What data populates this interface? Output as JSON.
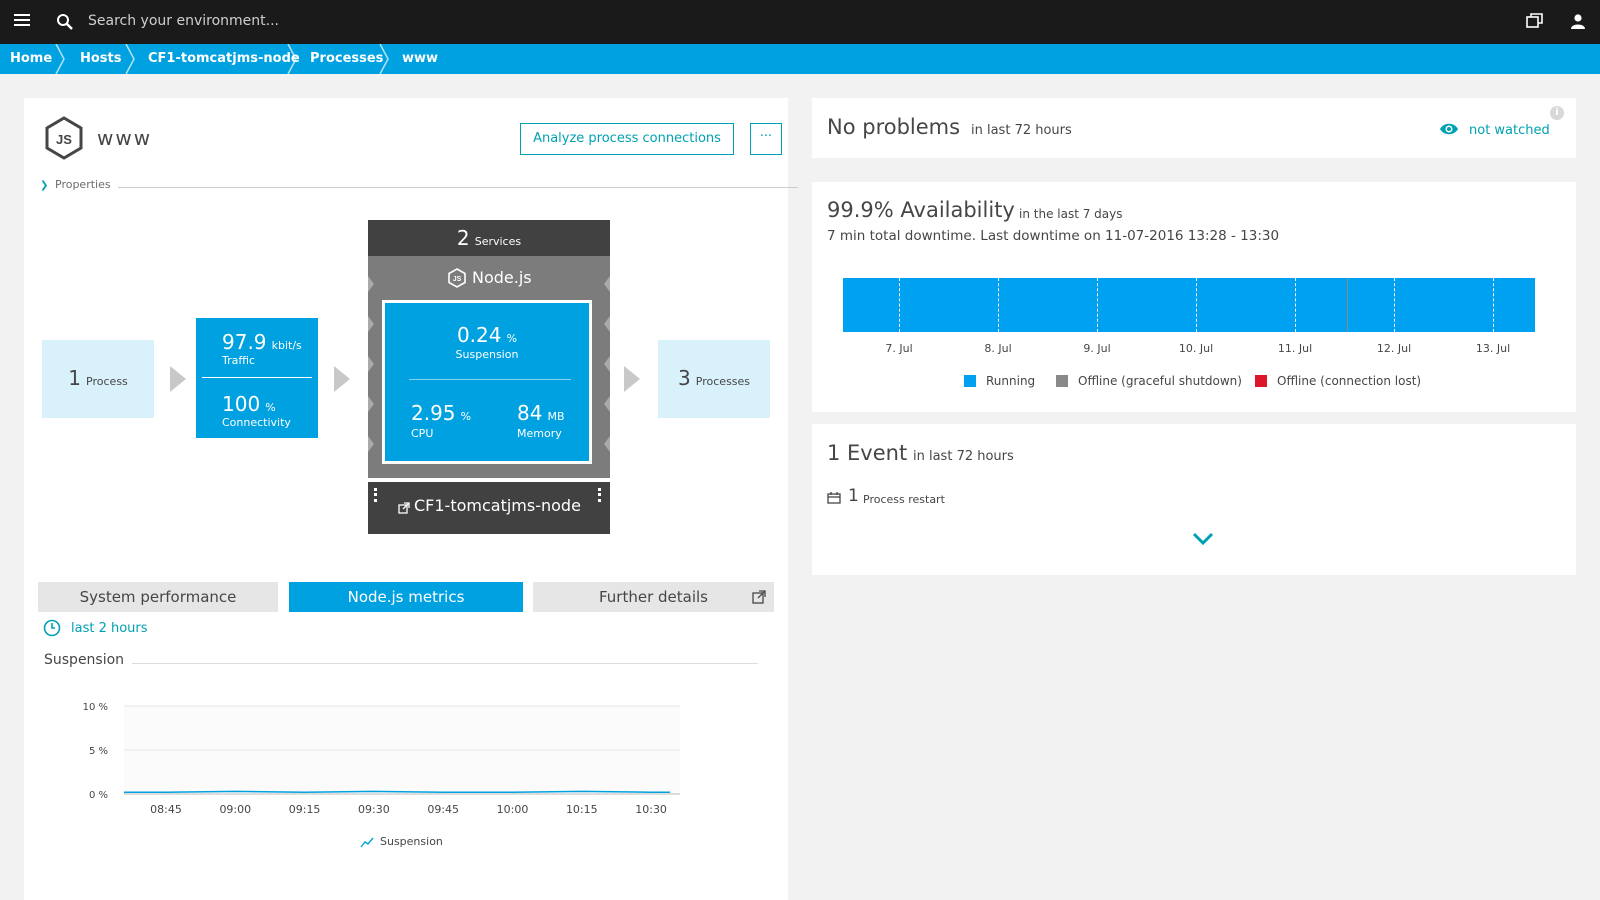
{
  "topbar": {
    "menu_icon": "hamburger-menu-icon",
    "search_placeholder": "Search your environment...",
    "window_icon": "windows-icon",
    "user_icon": "user-icon"
  },
  "breadcrumb": {
    "items": [
      "Home",
      "Hosts",
      "CF1-tomcatjms-node",
      "Processes",
      "www"
    ]
  },
  "process": {
    "title": "www",
    "analyze_button": "Analyze process connections",
    "more_button": "···",
    "properties_label": "Properties"
  },
  "flow": {
    "incoming": {
      "count": "1",
      "label": "Process"
    },
    "traffic": {
      "value": "97.9",
      "unit": "kbit/s",
      "label": "Traffic"
    },
    "connectivity": {
      "value": "100",
      "unit": "%",
      "label": "Connectivity"
    },
    "services": {
      "count": "2",
      "label": "Services"
    },
    "tech": "Node.js",
    "suspension": {
      "value": "0.24",
      "unit": "%",
      "label": "Suspension"
    },
    "cpu": {
      "value": "2.95",
      "unit": "%",
      "label": "CPU"
    },
    "memory": {
      "value": "84",
      "unit": "MB",
      "label": "Memory"
    },
    "host": "CF1-tomcatjms-node",
    "outgoing": {
      "count": "3",
      "label": "Processes"
    }
  },
  "tabs": {
    "system": "System performance",
    "nodejs": "Node.js metrics",
    "further": "Further details"
  },
  "timeframe": "last 2 hours",
  "suspension_chart": {
    "title": "Suspension",
    "legend": "Suspension",
    "y_ticks": [
      "10 %",
      "5 %",
      "0 %"
    ],
    "x_ticks": [
      "08:45",
      "09:00",
      "09:15",
      "09:30",
      "09:45",
      "10:00",
      "10:15",
      "10:30"
    ]
  },
  "problems": {
    "title": "No problems",
    "subtitle": "in last 72 hours",
    "watch_label": "not watched"
  },
  "availability": {
    "title": "99.9% Availability",
    "subtitle": "in the last 7 days",
    "detail": "7 min total downtime. Last downtime on 11-07-2016 13:28 - 13:30",
    "days": [
      "7. Jul",
      "8. Jul",
      "9. Jul",
      "10. Jul",
      "11. Jul",
      "12. Jul",
      "13. Jul"
    ],
    "legend": [
      {
        "label": "Running",
        "color": "#00a1f0"
      },
      {
        "label": "Offline (graceful shutdown)",
        "color": "#898989"
      },
      {
        "label": "Offline (connection lost)",
        "color": "#dc172a"
      }
    ]
  },
  "events": {
    "title": "1 Event",
    "subtitle": "in last 72 hours",
    "count": "1",
    "label": "Process restart"
  },
  "colors": {
    "accent": "#00a1e0",
    "teal": "#00a1b2",
    "dark": "#1a1a1a"
  },
  "chart_data": [
    {
      "type": "line",
      "title": "Suspension",
      "xlabel": "",
      "ylabel": "",
      "x": [
        "08:45",
        "09:00",
        "09:15",
        "09:30",
        "09:45",
        "10:00",
        "10:15",
        "10:30"
      ],
      "series": [
        {
          "name": "Suspension",
          "values": [
            0.2,
            0.3,
            0.2,
            0.3,
            0.2,
            0.2,
            0.3,
            0.2
          ]
        }
      ],
      "ylim": [
        0,
        10
      ],
      "y_unit": "%",
      "grid": true,
      "legend_position": "bottom"
    }
  ]
}
